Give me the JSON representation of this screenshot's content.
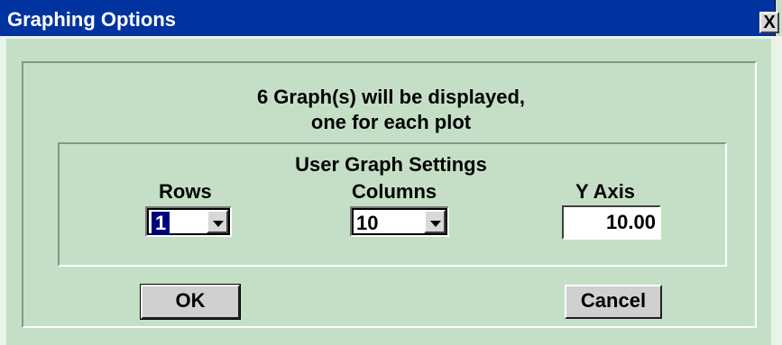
{
  "window": {
    "title": "Graphing Options",
    "close_glyph": "X"
  },
  "message": {
    "line1": "6 Graph(s) will be displayed,",
    "line2": "one for each plot"
  },
  "settings": {
    "group_title": "User Graph Settings",
    "rows": {
      "label": "Rows",
      "value": "1"
    },
    "columns": {
      "label": "Columns",
      "value": "10"
    },
    "y_axis": {
      "label": "Y Axis",
      "value": "10.00"
    }
  },
  "buttons": {
    "ok": "OK",
    "cancel": "Cancel"
  }
}
